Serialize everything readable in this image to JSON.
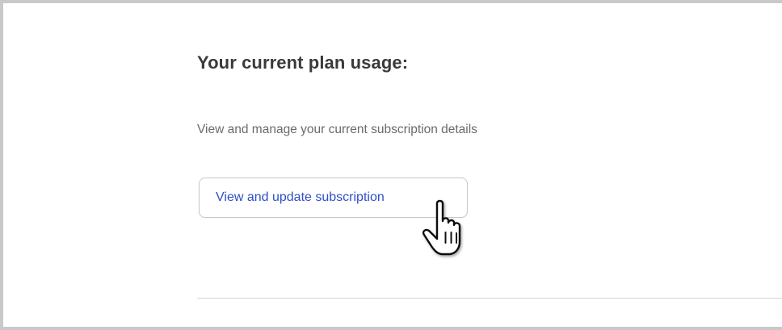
{
  "plan": {
    "title": "Your current plan usage:",
    "description": "View and manage your current subscription details",
    "update_button_label": "View and update subscription"
  },
  "cursor": {
    "icon": "hand-pointer-icon"
  }
}
